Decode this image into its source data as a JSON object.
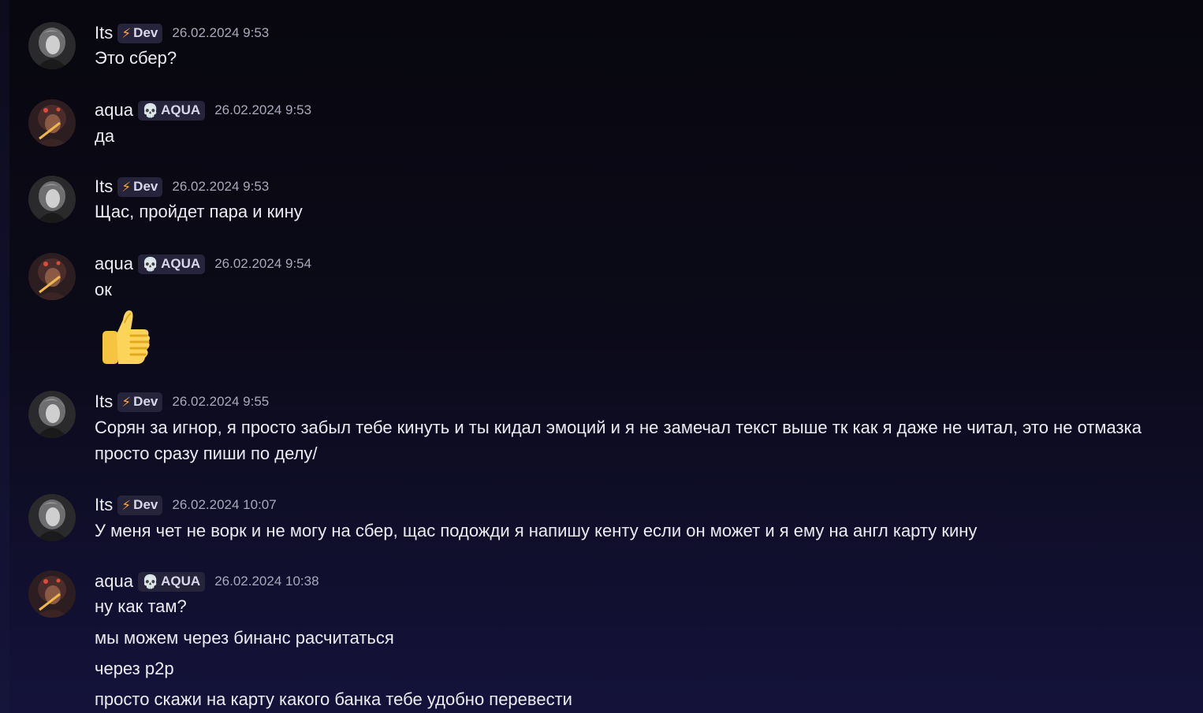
{
  "messages": [
    {
      "user": "Its",
      "role": "Dev",
      "role_icon": "lightning-bolt-icon",
      "timestamp": "26.02.2024 9:53",
      "lines": [
        "Это сбер?"
      ]
    },
    {
      "user": "aqua",
      "role": "AQUA",
      "role_icon": "skull-icon",
      "timestamp": "26.02.2024 9:53",
      "lines": [
        "да"
      ]
    },
    {
      "user": "Its",
      "role": "Dev",
      "role_icon": "lightning-bolt-icon",
      "timestamp": "26.02.2024 9:53",
      "lines": [
        "Щас, пройдет пара и кину"
      ]
    },
    {
      "user": "aqua",
      "role": "AQUA",
      "role_icon": "skull-icon",
      "timestamp": "26.02.2024 9:54",
      "lines": [
        "ок"
      ],
      "emoji": "thumbs-up-icon"
    },
    {
      "user": "Its",
      "role": "Dev",
      "role_icon": "lightning-bolt-icon",
      "timestamp": "26.02.2024 9:55",
      "lines": [
        "Сорян за игнор, я просто забыл тебе кинуть и ты кидал эмоций и я не замечал текст выше тк как я даже не читал, это не отмазка",
        "просто сразу пиши по делу/"
      ]
    },
    {
      "user": "Its",
      "role": "Dev",
      "role_icon": "lightning-bolt-icon",
      "timestamp": "26.02.2024 10:07",
      "lines": [
        "У меня чет не ворк и не могу на сбер, щас подожди я напишу кенту если он может и я ему на англ карту кину"
      ]
    },
    {
      "user": "aqua",
      "role": "AQUA",
      "role_icon": "skull-icon",
      "timestamp": "26.02.2024 10:38",
      "lines": [
        "ну как там?",
        "мы можем через бинанс расчитаться",
        "через p2p",
        "просто скажи на карту какого банка тебе удобно перевести"
      ]
    }
  ],
  "colors": {
    "background_top": "#08070f",
    "background_bottom": "#14123a",
    "text": "#ecebf3",
    "timestamp": "#a9a8ba",
    "badge_bg": "#25243a",
    "dev_bolt": "#f7a23a",
    "aqua_skull": "#b89af2"
  }
}
